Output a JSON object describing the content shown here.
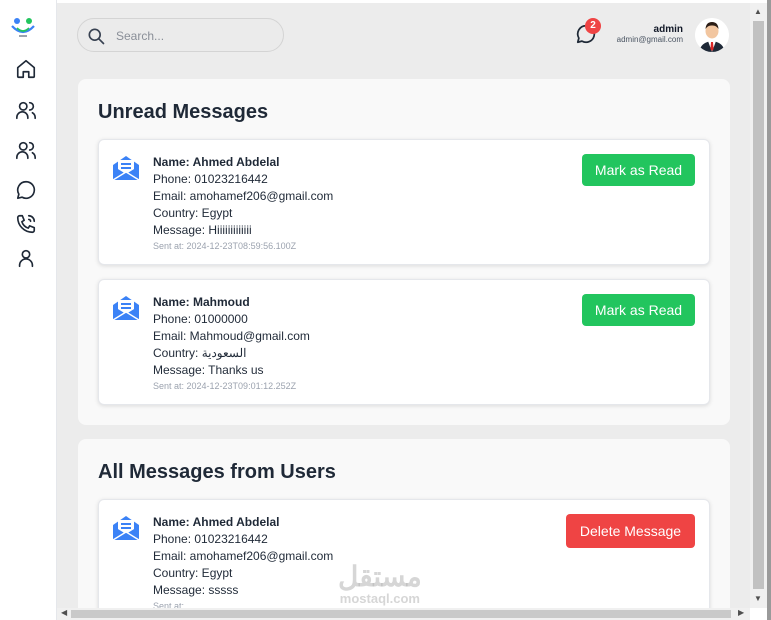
{
  "header": {
    "search_placeholder": "Search...",
    "notification_count": "2",
    "user_name": "admin",
    "user_email": "admin@gmail.com"
  },
  "sidebar": {
    "items": [
      {
        "icon": "home-icon"
      },
      {
        "icon": "users-icon"
      },
      {
        "icon": "users-group-icon"
      },
      {
        "icon": "chat-icon"
      },
      {
        "icon": "phone-icon"
      },
      {
        "icon": "user-icon"
      }
    ]
  },
  "unread": {
    "title": "Unread Messages",
    "button_label": "Mark as Read",
    "messages": [
      {
        "name": "Name: Ahmed Abdelal",
        "phone": "Phone: 01023216442",
        "email": "Email: amohamef206@gmail.com",
        "country": "Country: Egypt",
        "message": "Message: Hiiiiiiiiiiiii",
        "sent": "Sent at: 2024-12-23T08:59:56.100Z"
      },
      {
        "name": "Name: Mahmoud",
        "phone": "Phone: 01000000",
        "email": "Email: Mahmoud@gmail.com",
        "country": "Country: السعودية",
        "message": "Message: Thanks us",
        "sent": "Sent at: 2024-12-23T09:01:12.252Z"
      }
    ]
  },
  "all": {
    "title": "All Messages from Users",
    "button_label": "Delete Message",
    "messages": [
      {
        "name": "Name: Ahmed Abdelal",
        "phone": "Phone: 01023216442",
        "email": "Email: amohamef206@gmail.com",
        "country": "Country: Egypt",
        "message": "Message: sssss",
        "sent": "Sent at:"
      }
    ]
  },
  "watermark": {
    "arabic": "مستقل",
    "latin": "mostaql.com"
  },
  "colors": {
    "accent_green": "#22c55e",
    "accent_red": "#ef4444",
    "icon_blue": "#3b82f6"
  }
}
